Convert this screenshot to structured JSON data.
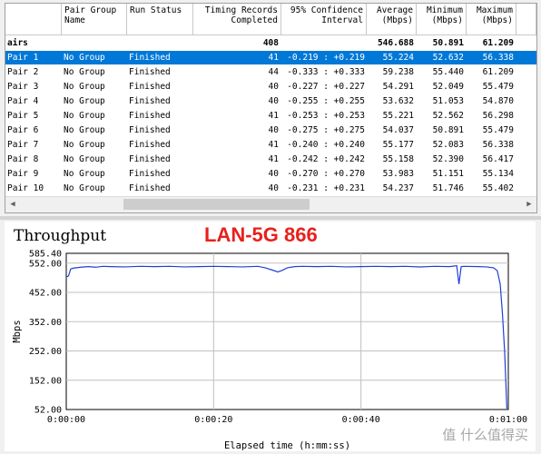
{
  "table": {
    "columns": [
      "",
      "Pair Group\nName",
      "Run Status",
      "Timing Records\nCompleted",
      "95% Confidence\nInterval",
      "Average\n(Mbps)",
      "Minimum\n(Mbps)",
      "Maximum\n(Mbps)"
    ],
    "total_row": [
      "airs",
      "",
      "",
      "408",
      "",
      "546.688",
      "50.891",
      "61.209"
    ],
    "rows": [
      [
        "Pair 1",
        "No Group",
        "Finished",
        "41",
        "-0.219 : +0.219",
        "55.224",
        "52.632",
        "56.338"
      ],
      [
        "Pair 2",
        "No Group",
        "Finished",
        "44",
        "-0.333 : +0.333",
        "59.238",
        "55.440",
        "61.209"
      ],
      [
        "Pair 3",
        "No Group",
        "Finished",
        "40",
        "-0.227 : +0.227",
        "54.291",
        "52.049",
        "55.479"
      ],
      [
        "Pair 4",
        "No Group",
        "Finished",
        "40",
        "-0.255 : +0.255",
        "53.632",
        "51.053",
        "54.870"
      ],
      [
        "Pair 5",
        "No Group",
        "Finished",
        "41",
        "-0.253 : +0.253",
        "55.221",
        "52.562",
        "56.298"
      ],
      [
        "Pair 6",
        "No Group",
        "Finished",
        "40",
        "-0.275 : +0.275",
        "54.037",
        "50.891",
        "55.479"
      ],
      [
        "Pair 7",
        "No Group",
        "Finished",
        "41",
        "-0.240 : +0.240",
        "55.177",
        "52.083",
        "56.338"
      ],
      [
        "Pair 8",
        "No Group",
        "Finished",
        "41",
        "-0.242 : +0.242",
        "55.158",
        "52.390",
        "56.417"
      ],
      [
        "Pair 9",
        "No Group",
        "Finished",
        "40",
        "-0.270 : +0.270",
        "53.983",
        "51.151",
        "55.134"
      ],
      [
        "Pair 10",
        "No Group",
        "Finished",
        "40",
        "-0.231 : +0.231",
        "54.237",
        "51.746",
        "55.402"
      ]
    ],
    "selected_index": 0
  },
  "chart": {
    "title": "Throughput",
    "overlay_label": "LAN-5G 866",
    "watermark": "值 什么值得买"
  },
  "chart_data": {
    "type": "line",
    "title": "Throughput",
    "xlabel": "Elapsed time (h:mm:ss)",
    "ylabel": "Mbps",
    "x_ticks": [
      "0:00:00",
      "0:00:20",
      "0:00:40",
      "0:01:00"
    ],
    "y_ticks": [
      "585.40",
      "552.00",
      "452.00",
      "352.00",
      "252.00",
      "152.00",
      "52.00"
    ],
    "xlim": [
      0,
      60
    ],
    "ylim": [
      52,
      585.4
    ],
    "grid": true,
    "series": [
      {
        "color": "#1f3fd6",
        "x": [
          0,
          0.3,
          0.6,
          1,
          2,
          3,
          4,
          5,
          6,
          8,
          10,
          12,
          14,
          16,
          18,
          20,
          22,
          24,
          26,
          27,
          28,
          28.7,
          29.3,
          30,
          31,
          32,
          34,
          36,
          38,
          40,
          42,
          44,
          46,
          48,
          50,
          52,
          53,
          53.3,
          53.6,
          54,
          56,
          57,
          58,
          58.5,
          58.9,
          59.2,
          59.5,
          59.8
        ],
        "y": [
          505,
          508,
          532,
          535,
          538,
          540,
          538,
          541,
          540,
          539,
          541,
          540,
          541,
          539,
          540,
          541,
          540,
          539,
          541,
          536,
          528,
          522,
          527,
          536,
          540,
          541,
          540,
          541,
          539,
          540,
          541,
          540,
          541,
          539,
          541,
          540,
          543,
          480,
          540,
          541,
          540,
          539,
          536,
          526,
          480,
          380,
          250,
          55
        ]
      }
    ]
  }
}
